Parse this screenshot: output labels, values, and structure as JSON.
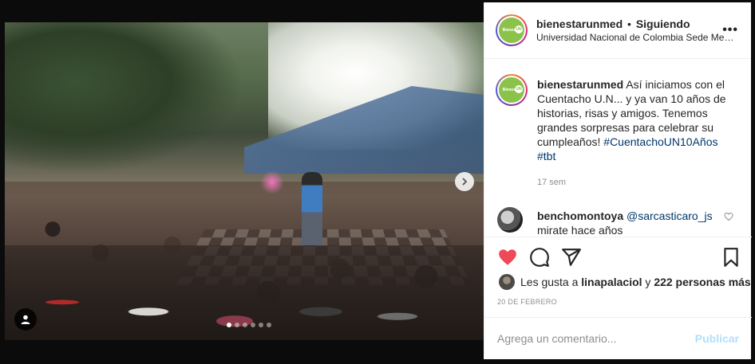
{
  "post": {
    "username": "bienestarunmed",
    "separator": "•",
    "follow_status": "Siguiendo",
    "location": "Universidad Nacional de Colombia Sede Medellín",
    "more_icon": "more-horizontal-icon",
    "avatar_text": "Bienestar",
    "avatar_badge": "UN"
  },
  "caption": {
    "username": "bienestarunmed",
    "text_before": "Así iniciamos con el Cuentacho U.N... y ya van 10 años de historias, risas y amigos. Tenemos grandes sorpresas para celebrar su cumpleaños! ",
    "hashtag1": "#CuentachoUN10Años",
    "hashtag2": "#tbt",
    "time": "17 sem"
  },
  "comment": {
    "username": "benchomontoya",
    "mention": "@sarcasticaro_js",
    "text": "mirate hace años"
  },
  "likes": {
    "prefix": "Les gusta a",
    "user": "linapalaciol",
    "connector": "y",
    "count": "222 personas más"
  },
  "date": "20 DE FEBRERO",
  "add_comment": {
    "placeholder": "Agrega un comentario...",
    "publish": "Publicar"
  },
  "carousel": {
    "total": 6,
    "active": 0
  },
  "colors": {
    "heart": "#ed4956",
    "link": "#00376b",
    "publish": "#b2dffc"
  }
}
